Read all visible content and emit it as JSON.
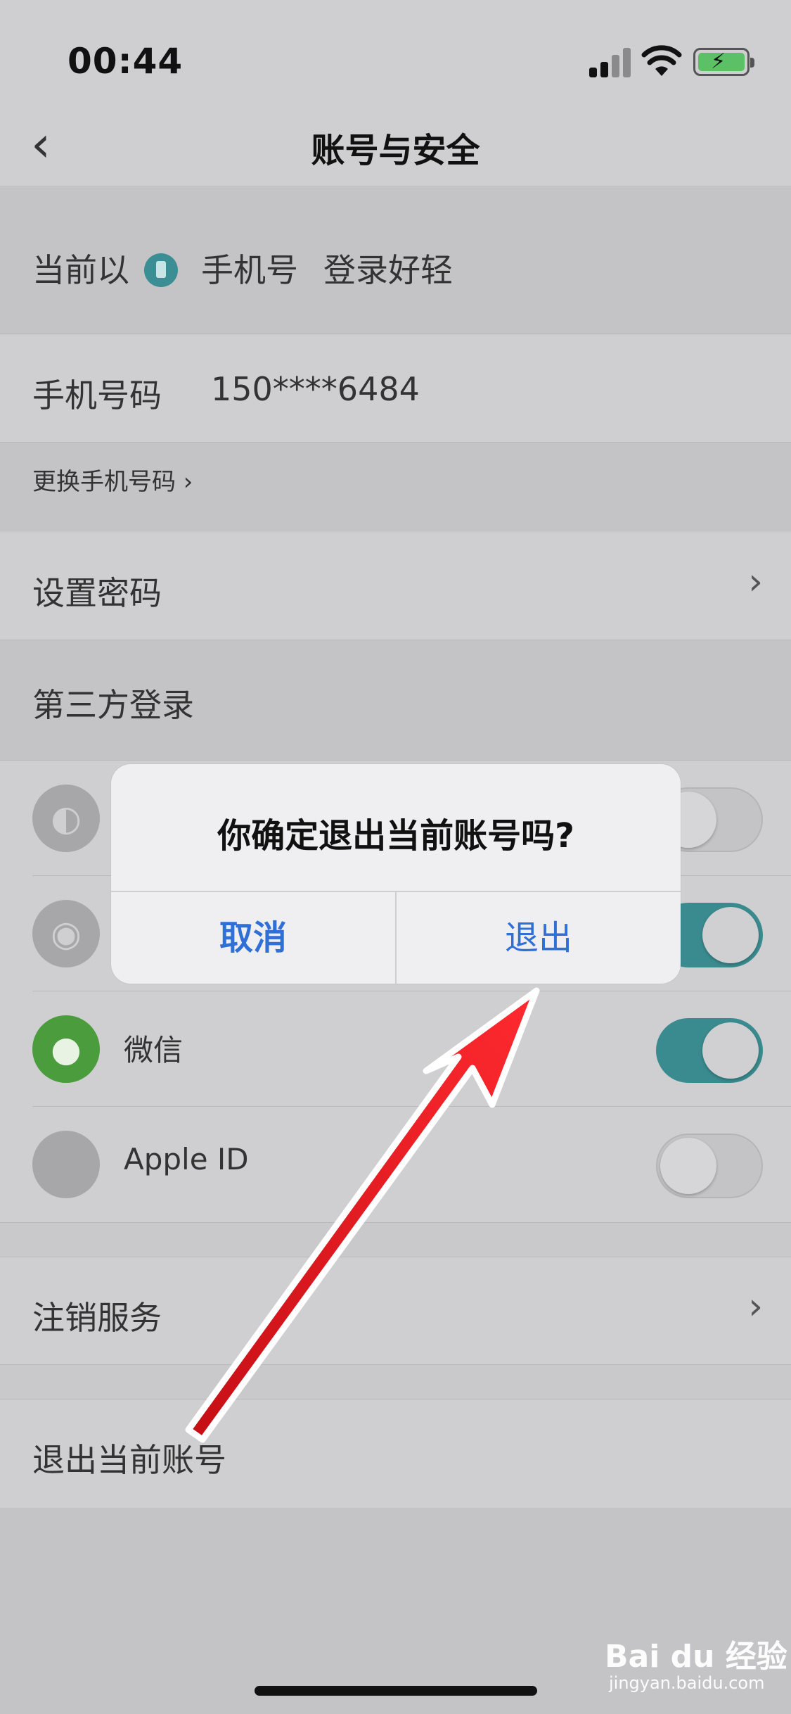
{
  "status_bar": {
    "time": "00:44"
  },
  "nav": {
    "title": "账号与安全"
  },
  "login_method": {
    "prefix": "当前以",
    "method": "手机号",
    "suffix": "登录好轻"
  },
  "phone": {
    "label": "手机号码",
    "value": "150****6484"
  },
  "change_phone": {
    "label": "更换手机号码"
  },
  "set_password": {
    "label": "设置密码"
  },
  "third_party": {
    "label": "第三方登录"
  },
  "social_items": [
    {
      "name": "",
      "icon": "qq-icon",
      "enabled": false
    },
    {
      "name": "",
      "icon": "weibo-icon",
      "enabled": true
    },
    {
      "name": "微信",
      "icon": "wechat-icon",
      "enabled": true
    },
    {
      "name": "Apple ID",
      "icon": "apple-icon",
      "enabled": false
    }
  ],
  "cancel_service": {
    "label": "注销服务"
  },
  "logout": {
    "label": "退出当前账号"
  },
  "dialog": {
    "message": "你确定退出当前账号吗?",
    "cancel_label": "取消",
    "confirm_label": "退出"
  },
  "watermark": {
    "brand": "Bai du 经验",
    "site": "jingyan.baidu.com"
  },
  "colors": {
    "accent_blue": "#2f6fd6",
    "toggle_on": "#3a8b8f",
    "annotation_arrow": "#e8141b"
  }
}
